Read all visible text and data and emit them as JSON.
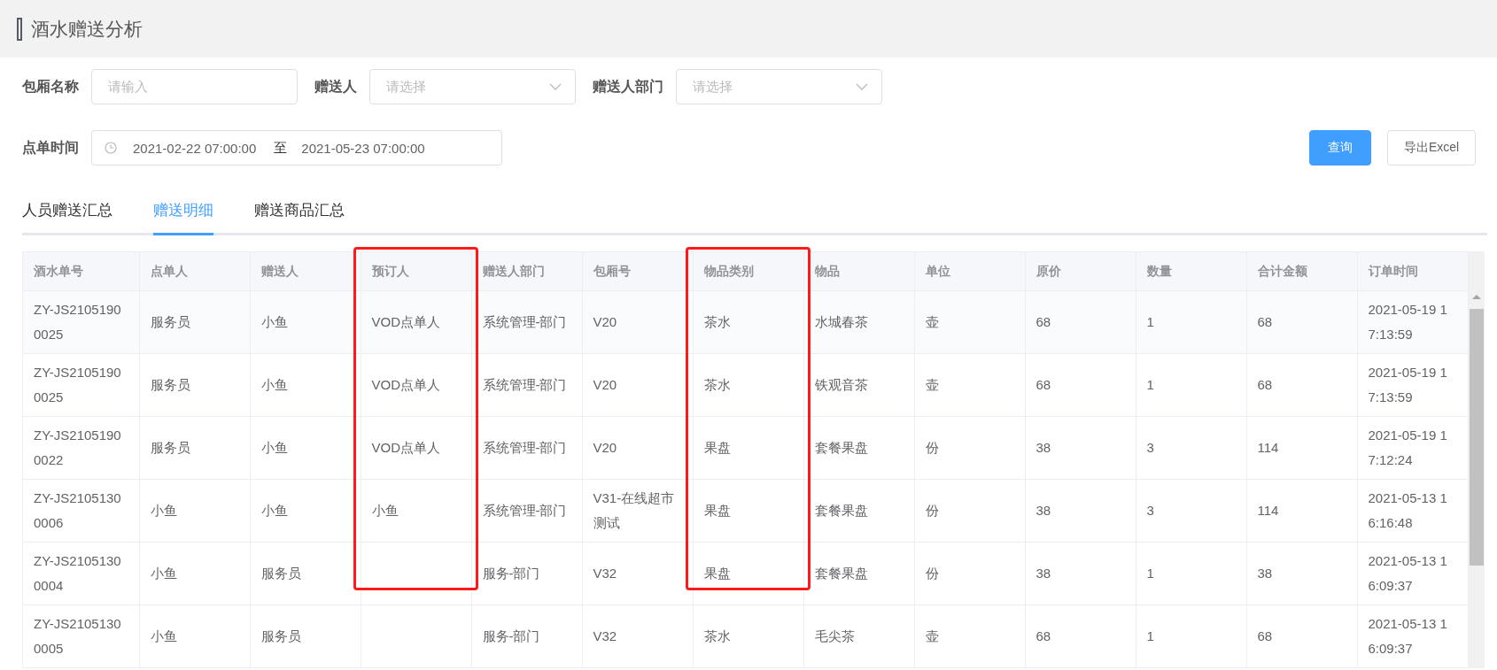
{
  "page_title": "酒水赠送分析",
  "filters": [
    {
      "kind": "text",
      "label": "包厢名称",
      "placeholder": "请输入"
    },
    {
      "kind": "select",
      "label": "赠送人",
      "placeholder": "请选择"
    },
    {
      "kind": "select",
      "label": "赠送人部门",
      "placeholder": "请选择"
    }
  ],
  "time_filter": {
    "label": "点单时间",
    "start": "2021-02-22 07:00:00",
    "separator": "至",
    "end": "2021-05-23 07:00:00"
  },
  "buttons": [
    {
      "kind": "primary",
      "label": "查询"
    },
    {
      "kind": "default",
      "label": "导出Excel"
    }
  ],
  "tabs": [
    {
      "label": "人员赠送汇总",
      "selected": false
    },
    {
      "label": "赠送明细",
      "selected": true
    },
    {
      "label": "赠送商品汇总",
      "selected": false
    }
  ],
  "table": {
    "columns": [
      {
        "label": "酒水单号",
        "highlighted": false
      },
      {
        "label": "点单人",
        "highlighted": false
      },
      {
        "label": "赠送人",
        "highlighted": false
      },
      {
        "label": "预订人",
        "highlighted": true
      },
      {
        "label": "赠送人部门",
        "highlighted": false
      },
      {
        "label": "包厢号",
        "highlighted": false
      },
      {
        "label": "物品类别",
        "highlighted": true
      },
      {
        "label": "物品",
        "highlighted": false
      },
      {
        "label": "单位",
        "highlighted": false
      },
      {
        "label": "原价",
        "highlighted": false
      },
      {
        "label": "数量",
        "highlighted": false
      },
      {
        "label": "合计金额",
        "highlighted": false
      },
      {
        "label": "订单时间",
        "highlighted": false
      }
    ],
    "rows": [
      [
        "ZY-JS21051900025",
        "服务员",
        "小鱼",
        "VOD点单人",
        "系统管理-部门",
        "V20",
        "茶水",
        "水城春茶",
        "壶",
        "68",
        "1",
        "68",
        "2021-05-19 17:13:59"
      ],
      [
        "ZY-JS21051900025",
        "服务员",
        "小鱼",
        "VOD点单人",
        "系统管理-部门",
        "V20",
        "茶水",
        "铁观音茶",
        "壶",
        "68",
        "1",
        "68",
        "2021-05-19 17:13:59"
      ],
      [
        "ZY-JS21051900022",
        "服务员",
        "小鱼",
        "VOD点单人",
        "系统管理-部门",
        "V20",
        "果盘",
        "套餐果盘",
        "份",
        "38",
        "3",
        "114",
        "2021-05-19 17:12:24"
      ],
      [
        "ZY-JS21051300006",
        "小鱼",
        "小鱼",
        "小鱼",
        "系统管理-部门",
        "V31-在线超市测试",
        "果盘",
        "套餐果盘",
        "份",
        "38",
        "3",
        "114",
        "2021-05-13 16:16:48"
      ],
      [
        "ZY-JS21051300004",
        "小鱼",
        "服务员",
        "",
        "服务-部门",
        "V32",
        "果盘",
        "套餐果盘",
        "份",
        "38",
        "1",
        "38",
        "2021-05-13 16:09:37"
      ],
      [
        "ZY-JS21051300005",
        "小鱼",
        "服务员",
        "",
        "服务-部门",
        "V32",
        "茶水",
        "毛尖茶",
        "壶",
        "68",
        "1",
        "68",
        "2021-05-13 16:09:37"
      ]
    ]
  }
}
